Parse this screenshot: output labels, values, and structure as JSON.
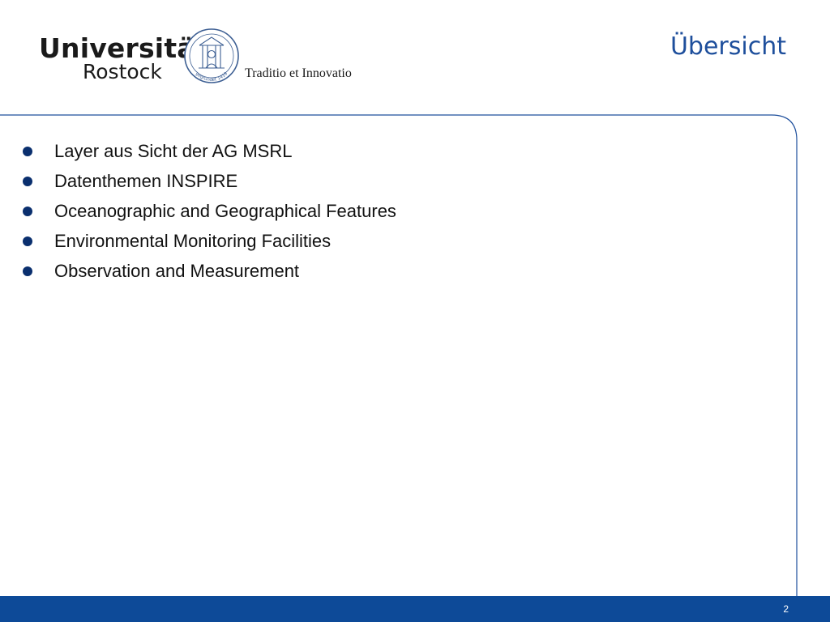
{
  "header": {
    "logo": {
      "line1": "Universität",
      "line2": "Rostock",
      "tagline": "Traditio et Innovatio",
      "seal_text": "gegründet 1419"
    },
    "title": "Übersicht"
  },
  "content": {
    "bullets": [
      {
        "text": "Layer aus Sicht der AG MSRL"
      },
      {
        "text": "Datenthemen INSPIRE"
      },
      {
        "text": "Oceanographic and Geographical Features"
      },
      {
        "text": "Environmental Monitoring Facilities"
      },
      {
        "text": "Observation and Measurement"
      }
    ]
  },
  "footer": {
    "page_number": "2"
  },
  "colors": {
    "accent_blue": "#1e4f9c",
    "footer_blue": "#0d4a98",
    "bullet_navy": "#0a2f6e"
  }
}
